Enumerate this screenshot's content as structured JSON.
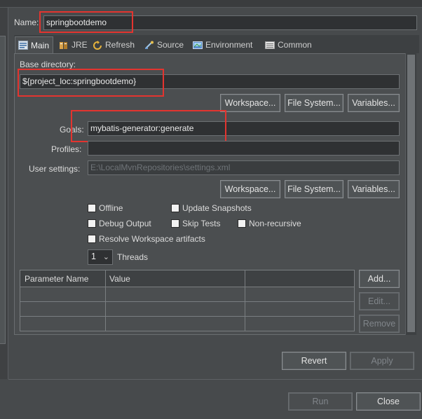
{
  "name": {
    "label": "Name:",
    "value": "springbootdemo"
  },
  "tabs": [
    {
      "label": "Main",
      "icon": "main-tab-icon",
      "active": true
    },
    {
      "label": "JRE",
      "icon": "jre-icon"
    },
    {
      "label": "Refresh",
      "icon": "refresh-icon"
    },
    {
      "label": "Source",
      "icon": "source-icon"
    },
    {
      "label": "Environment",
      "icon": "environment-icon"
    },
    {
      "label": "Common",
      "icon": "common-icon"
    }
  ],
  "base_directory": {
    "label": "Base directory:",
    "value": "${project_loc:springbootdemo}",
    "buttons": {
      "workspace": "Workspace...",
      "file_system": "File System...",
      "variables": "Variables..."
    }
  },
  "goals": {
    "label": "Goals:",
    "value": "mybatis-generator:generate"
  },
  "profiles": {
    "label": "Profiles:",
    "value": ""
  },
  "user_settings": {
    "label": "User settings:",
    "value": "E:\\LocalMvnRepositories\\settings.xml",
    "buttons": {
      "workspace": "Workspace...",
      "file_system": "File System...",
      "variables": "Variables..."
    }
  },
  "options": {
    "offline": "Offline",
    "update_snapshots": "Update Snapshots",
    "debug_output": "Debug Output",
    "skip_tests": "Skip Tests",
    "non_recursive": "Non-recursive",
    "resolve_workspace": "Resolve Workspace artifacts"
  },
  "threads": {
    "value": "1",
    "label": "Threads"
  },
  "parameters": {
    "columns": [
      "Parameter Name",
      "Value",
      ""
    ],
    "rows": [],
    "buttons": {
      "add": "Add...",
      "edit": "Edit...",
      "remove": "Remove"
    }
  },
  "footer": {
    "revert": "Revert",
    "apply": "Apply",
    "run": "Run",
    "close": "Close"
  },
  "colors": {
    "highlight": "#e3342f",
    "background": "#474a4c"
  }
}
